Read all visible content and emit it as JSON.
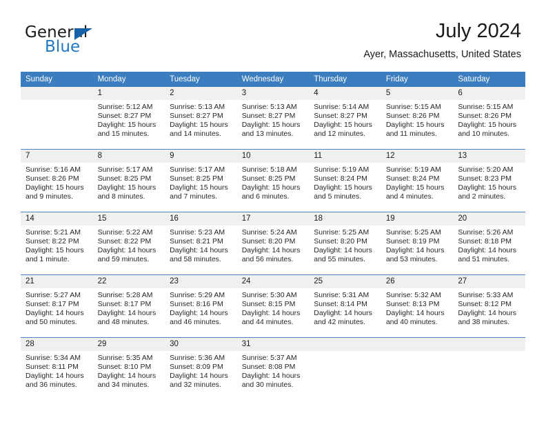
{
  "brand": {
    "name_part1": "General",
    "name_part2": "Blue",
    "accent_color": "#1f77c4",
    "triangle_color": "#1761a8"
  },
  "header": {
    "title": "July 2024",
    "location": "Ayer, Massachusetts, United States"
  },
  "theme": {
    "header_row_bg": "#3b7dbf",
    "daynum_bg": "#f0f0f0",
    "row_divider": "#4a86c5",
    "page_bg": "#ffffff"
  },
  "weekday_headers": [
    "Sunday",
    "Monday",
    "Tuesday",
    "Wednesday",
    "Thursday",
    "Friday",
    "Saturday"
  ],
  "weeks": [
    [
      {
        "day": "",
        "empty": true,
        "sunrise": "",
        "sunset": "",
        "daylight1": "",
        "daylight2": ""
      },
      {
        "day": "1",
        "sunrise": "Sunrise: 5:12 AM",
        "sunset": "Sunset: 8:27 PM",
        "daylight1": "Daylight: 15 hours",
        "daylight2": "and 15 minutes."
      },
      {
        "day": "2",
        "sunrise": "Sunrise: 5:13 AM",
        "sunset": "Sunset: 8:27 PM",
        "daylight1": "Daylight: 15 hours",
        "daylight2": "and 14 minutes."
      },
      {
        "day": "3",
        "sunrise": "Sunrise: 5:13 AM",
        "sunset": "Sunset: 8:27 PM",
        "daylight1": "Daylight: 15 hours",
        "daylight2": "and 13 minutes."
      },
      {
        "day": "4",
        "sunrise": "Sunrise: 5:14 AM",
        "sunset": "Sunset: 8:27 PM",
        "daylight1": "Daylight: 15 hours",
        "daylight2": "and 12 minutes."
      },
      {
        "day": "5",
        "sunrise": "Sunrise: 5:15 AM",
        "sunset": "Sunset: 8:26 PM",
        "daylight1": "Daylight: 15 hours",
        "daylight2": "and 11 minutes."
      },
      {
        "day": "6",
        "sunrise": "Sunrise: 5:15 AM",
        "sunset": "Sunset: 8:26 PM",
        "daylight1": "Daylight: 15 hours",
        "daylight2": "and 10 minutes."
      }
    ],
    [
      {
        "day": "7",
        "sunrise": "Sunrise: 5:16 AM",
        "sunset": "Sunset: 8:26 PM",
        "daylight1": "Daylight: 15 hours",
        "daylight2": "and 9 minutes."
      },
      {
        "day": "8",
        "sunrise": "Sunrise: 5:17 AM",
        "sunset": "Sunset: 8:25 PM",
        "daylight1": "Daylight: 15 hours",
        "daylight2": "and 8 minutes."
      },
      {
        "day": "9",
        "sunrise": "Sunrise: 5:17 AM",
        "sunset": "Sunset: 8:25 PM",
        "daylight1": "Daylight: 15 hours",
        "daylight2": "and 7 minutes."
      },
      {
        "day": "10",
        "sunrise": "Sunrise: 5:18 AM",
        "sunset": "Sunset: 8:25 PM",
        "daylight1": "Daylight: 15 hours",
        "daylight2": "and 6 minutes."
      },
      {
        "day": "11",
        "sunrise": "Sunrise: 5:19 AM",
        "sunset": "Sunset: 8:24 PM",
        "daylight1": "Daylight: 15 hours",
        "daylight2": "and 5 minutes."
      },
      {
        "day": "12",
        "sunrise": "Sunrise: 5:19 AM",
        "sunset": "Sunset: 8:24 PM",
        "daylight1": "Daylight: 15 hours",
        "daylight2": "and 4 minutes."
      },
      {
        "day": "13",
        "sunrise": "Sunrise: 5:20 AM",
        "sunset": "Sunset: 8:23 PM",
        "daylight1": "Daylight: 15 hours",
        "daylight2": "and 2 minutes."
      }
    ],
    [
      {
        "day": "14",
        "sunrise": "Sunrise: 5:21 AM",
        "sunset": "Sunset: 8:22 PM",
        "daylight1": "Daylight: 15 hours",
        "daylight2": "and 1 minute."
      },
      {
        "day": "15",
        "sunrise": "Sunrise: 5:22 AM",
        "sunset": "Sunset: 8:22 PM",
        "daylight1": "Daylight: 14 hours",
        "daylight2": "and 59 minutes."
      },
      {
        "day": "16",
        "sunrise": "Sunrise: 5:23 AM",
        "sunset": "Sunset: 8:21 PM",
        "daylight1": "Daylight: 14 hours",
        "daylight2": "and 58 minutes."
      },
      {
        "day": "17",
        "sunrise": "Sunrise: 5:24 AM",
        "sunset": "Sunset: 8:20 PM",
        "daylight1": "Daylight: 14 hours",
        "daylight2": "and 56 minutes."
      },
      {
        "day": "18",
        "sunrise": "Sunrise: 5:25 AM",
        "sunset": "Sunset: 8:20 PM",
        "daylight1": "Daylight: 14 hours",
        "daylight2": "and 55 minutes."
      },
      {
        "day": "19",
        "sunrise": "Sunrise: 5:25 AM",
        "sunset": "Sunset: 8:19 PM",
        "daylight1": "Daylight: 14 hours",
        "daylight2": "and 53 minutes."
      },
      {
        "day": "20",
        "sunrise": "Sunrise: 5:26 AM",
        "sunset": "Sunset: 8:18 PM",
        "daylight1": "Daylight: 14 hours",
        "daylight2": "and 51 minutes."
      }
    ],
    [
      {
        "day": "21",
        "sunrise": "Sunrise: 5:27 AM",
        "sunset": "Sunset: 8:17 PM",
        "daylight1": "Daylight: 14 hours",
        "daylight2": "and 50 minutes."
      },
      {
        "day": "22",
        "sunrise": "Sunrise: 5:28 AM",
        "sunset": "Sunset: 8:17 PM",
        "daylight1": "Daylight: 14 hours",
        "daylight2": "and 48 minutes."
      },
      {
        "day": "23",
        "sunrise": "Sunrise: 5:29 AM",
        "sunset": "Sunset: 8:16 PM",
        "daylight1": "Daylight: 14 hours",
        "daylight2": "and 46 minutes."
      },
      {
        "day": "24",
        "sunrise": "Sunrise: 5:30 AM",
        "sunset": "Sunset: 8:15 PM",
        "daylight1": "Daylight: 14 hours",
        "daylight2": "and 44 minutes."
      },
      {
        "day": "25",
        "sunrise": "Sunrise: 5:31 AM",
        "sunset": "Sunset: 8:14 PM",
        "daylight1": "Daylight: 14 hours",
        "daylight2": "and 42 minutes."
      },
      {
        "day": "26",
        "sunrise": "Sunrise: 5:32 AM",
        "sunset": "Sunset: 8:13 PM",
        "daylight1": "Daylight: 14 hours",
        "daylight2": "and 40 minutes."
      },
      {
        "day": "27",
        "sunrise": "Sunrise: 5:33 AM",
        "sunset": "Sunset: 8:12 PM",
        "daylight1": "Daylight: 14 hours",
        "daylight2": "and 38 minutes."
      }
    ],
    [
      {
        "day": "28",
        "sunrise": "Sunrise: 5:34 AM",
        "sunset": "Sunset: 8:11 PM",
        "daylight1": "Daylight: 14 hours",
        "daylight2": "and 36 minutes."
      },
      {
        "day": "29",
        "sunrise": "Sunrise: 5:35 AM",
        "sunset": "Sunset: 8:10 PM",
        "daylight1": "Daylight: 14 hours",
        "daylight2": "and 34 minutes."
      },
      {
        "day": "30",
        "sunrise": "Sunrise: 5:36 AM",
        "sunset": "Sunset: 8:09 PM",
        "daylight1": "Daylight: 14 hours",
        "daylight2": "and 32 minutes."
      },
      {
        "day": "31",
        "sunrise": "Sunrise: 5:37 AM",
        "sunset": "Sunset: 8:08 PM",
        "daylight1": "Daylight: 14 hours",
        "daylight2": "and 30 minutes."
      },
      {
        "day": "",
        "empty": true,
        "sunrise": "",
        "sunset": "",
        "daylight1": "",
        "daylight2": ""
      },
      {
        "day": "",
        "empty": true,
        "sunrise": "",
        "sunset": "",
        "daylight1": "",
        "daylight2": ""
      },
      {
        "day": "",
        "empty": true,
        "sunrise": "",
        "sunset": "",
        "daylight1": "",
        "daylight2": ""
      }
    ]
  ]
}
